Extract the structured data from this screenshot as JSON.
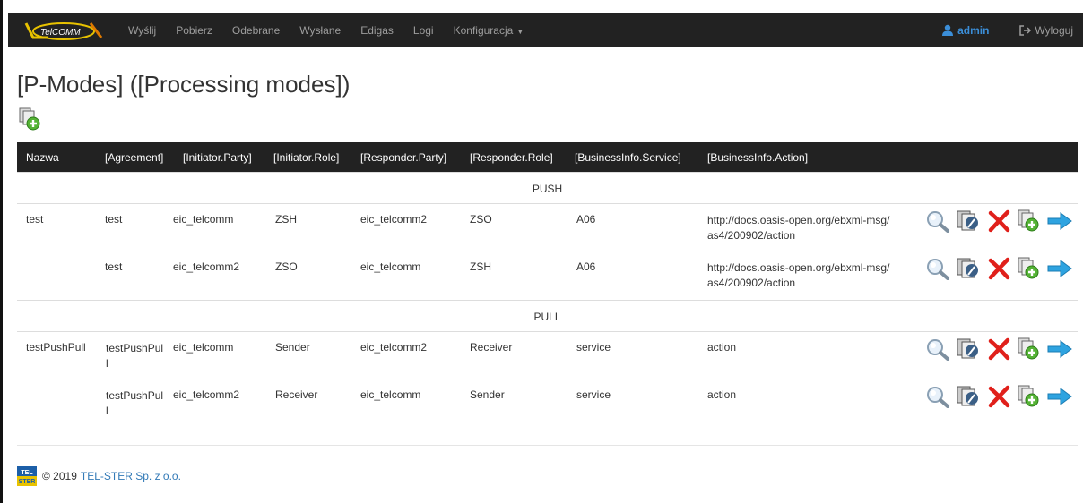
{
  "brand": {
    "logo_text": "TelCOMM"
  },
  "nav": {
    "items": [
      "Wyślij",
      "Pobierz",
      "Odebrane",
      "Wysłane",
      "Edigas",
      "Logi"
    ],
    "config_label": "Konfiguracja",
    "user": "admin",
    "logout": "Wyloguj"
  },
  "page": {
    "title": "[P-Modes] ([Processing modes])"
  },
  "table": {
    "headers": [
      "Nazwa",
      "[Agreement]",
      "[Initiator.Party]",
      "[Initiator.Role]",
      "[Responder.Party]",
      "[Responder.Role]",
      "[BusinessInfo.Service]",
      "[BusinessInfo.Action]"
    ],
    "groups": [
      {
        "label": "PUSH",
        "rows": [
          {
            "name": "test",
            "agreement": "test",
            "initiator_party": "eic_telcomm",
            "initiator_role": "ZSH",
            "responder_party": "eic_telcomm2",
            "responder_role": "ZSO",
            "service": "A06",
            "action": "http://docs.oasis-open.org/ebxml-msg/ as4/200902/action"
          },
          {
            "name": "",
            "agreement": "test",
            "initiator_party": "eic_telcomm2",
            "initiator_role": "ZSO",
            "responder_party": "eic_telcomm",
            "responder_role": "ZSH",
            "service": "A06",
            "action": "http://docs.oasis-open.org/ebxml-msg/ as4/200902/action"
          }
        ]
      },
      {
        "label": "PULL",
        "rows": [
          {
            "name": "testPushPull",
            "agreement": "testPushPul l",
            "initiator_party": "eic_telcomm",
            "initiator_role": "Sender",
            "responder_party": "eic_telcomm2",
            "responder_role": "Receiver",
            "service": "service",
            "action": "action"
          },
          {
            "name": "",
            "agreement": "testPushPul l",
            "initiator_party": "eic_telcomm2",
            "initiator_role": "Receiver",
            "responder_party": "eic_telcomm",
            "responder_role": "Sender",
            "service": "service",
            "action": "action"
          }
        ]
      }
    ],
    "row_actions": [
      "search-icon",
      "edit-icon",
      "delete-icon",
      "add-copy-icon",
      "arrow-right-icon"
    ]
  },
  "footer": {
    "logo_text": "TEL STER",
    "copyright": "© 2019",
    "company": "TEL-STER Sp. z o.o."
  },
  "colors": {
    "navbar": "#222222",
    "link": "#337ab7",
    "delete": "#e0201b",
    "add": "#55b335",
    "arrow": "#2ea3e0"
  }
}
